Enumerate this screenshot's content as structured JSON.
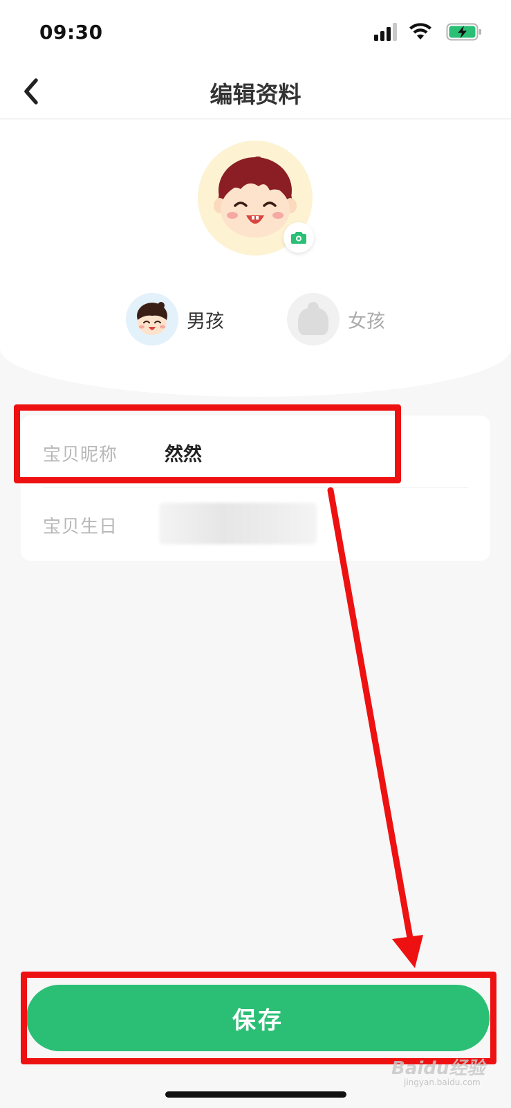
{
  "status_bar": {
    "time": "09:30",
    "icons": [
      "signal-icon",
      "wifi-icon",
      "battery-charging-icon"
    ],
    "battery_color": "#2bbf76"
  },
  "nav": {
    "back_icon": "chevron-left-icon",
    "title": "编辑资料"
  },
  "profile": {
    "avatar_icon": "boy-avatar",
    "camera_icon": "camera-icon",
    "gender_options": [
      {
        "label": "男孩",
        "icon": "boy-face-icon",
        "selected": true
      },
      {
        "label": "女孩",
        "icon": "girl-face-icon",
        "selected": false
      }
    ]
  },
  "form": {
    "nickname_label": "宝贝昵称",
    "nickname_value": "然然",
    "birthday_label": "宝贝生日",
    "birthday_value": ""
  },
  "actions": {
    "save_label": "保存"
  },
  "annotations": {
    "color": "#ee1111"
  },
  "watermark": {
    "text": "Baidu经验",
    "sub": "jingyan.baidu.com"
  },
  "colors": {
    "accent": "#2bbf76",
    "avatar_bg": "#fdf3d2",
    "boy_bg": "#e3f1fb"
  }
}
